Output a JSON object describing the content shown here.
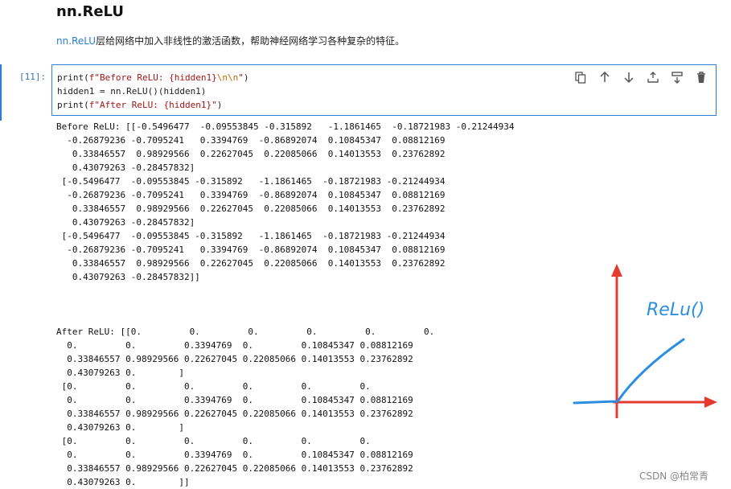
{
  "section": {
    "title": "nn.ReLU",
    "description_code": "nn.ReLU",
    "description_text": "层给网络中加入非线性的激活函数，帮助神经网络学习各种复杂的特征。"
  },
  "cell": {
    "prompt": "[11]:",
    "code_lines": [
      "print(f\"Before ReLU: {hidden1}\\n\\n\")",
      "hidden1 = nn.ReLU()(hidden1)",
      "print(f\"After ReLU: {hidden1}\")"
    ],
    "toolbar": [
      {
        "name": "copy-cell",
        "icon": "copy-icon"
      },
      {
        "name": "move-up",
        "icon": "arrow-up-icon"
      },
      {
        "name": "move-down",
        "icon": "arrow-down-icon"
      },
      {
        "name": "insert-above",
        "icon": "insert-above-icon"
      },
      {
        "name": "insert-below",
        "icon": "insert-below-icon"
      },
      {
        "name": "delete-cell",
        "icon": "trash-icon"
      }
    ]
  },
  "output": {
    "before": "Before ReLU: [[-0.5496477  -0.09553845 -0.315892   -1.1861465  -0.18721983 -0.21244934\n  -0.26879236 -0.7095241   0.3394769  -0.86892074  0.10845347  0.08812169\n   0.33846557  0.98929566  0.22627045  0.22085066  0.14013553  0.23762892\n   0.43079263 -0.28457832]\n [-0.5496477  -0.09553845 -0.315892   -1.1861465  -0.18721983 -0.21244934\n  -0.26879236 -0.7095241   0.3394769  -0.86892074  0.10845347  0.08812169\n   0.33846557  0.98929566  0.22627045  0.22085066  0.14013553  0.23762892\n   0.43079263 -0.28457832]\n [-0.5496477  -0.09553845 -0.315892   -1.1861465  -0.18721983 -0.21244934\n  -0.26879236 -0.7095241   0.3394769  -0.86892074  0.10845347  0.08812169\n   0.33846557  0.98929566  0.22627045  0.22085066  0.14013553  0.23762892\n   0.43079263 -0.28457832]]",
    "after": "After ReLU: [[0.         0.         0.         0.         0.         0.\n  0.         0.         0.3394769  0.         0.10845347 0.08812169\n  0.33846557 0.98929566 0.22627045 0.22085066 0.14013553 0.23762892\n  0.43079263 0.        ]\n [0.         0.         0.         0.         0.         0.\n  0.         0.         0.3394769  0.         0.10845347 0.08812169\n  0.33846557 0.98929566 0.22627045 0.22085066 0.14013553 0.23762892\n  0.43079263 0.        ]\n [0.         0.         0.         0.         0.         0.\n  0.         0.         0.3394769  0.         0.10845347 0.08812169\n  0.33846557 0.98929566 0.22627045 0.22085066 0.14013553 0.23762892\n  0.43079263 0.        ]]"
  },
  "sketch": {
    "label": "ReLu()",
    "axis_color": "#e53a2f",
    "curve_color": "#2c8ee0"
  },
  "watermark": "CSDN @柏常青",
  "colors": {
    "accent": "#2a7fd4",
    "prompt": "#3a6fb8",
    "string": "#a31515"
  }
}
